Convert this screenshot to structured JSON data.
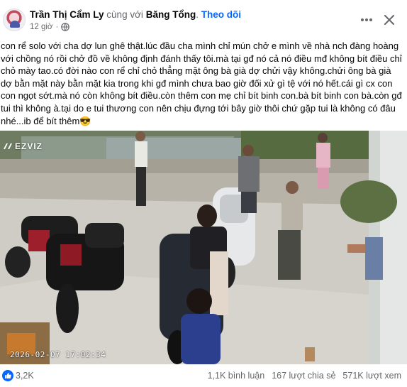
{
  "header": {
    "author": "Trần Thị Cẩm Ly",
    "with_text": "cùng với",
    "tagged": "Băng Tổng",
    "separator": ".",
    "follow_label": "Theo dõi",
    "time": "12 giờ",
    "dot": "·",
    "more_icon": "more-horizontal-icon",
    "close_icon": "close-icon",
    "privacy_icon": "globe-icon"
  },
  "post": {
    "text": "con rể solo với cha dợ lun ghê thật.lúc đầu cha mình chỉ mún chở e mình về nhà nch đàng hoàng với chồng nó rồi chở đồ về không định đánh thấy tôi.mà tại gđ nó cả nó điều mđ không bít điều chỉ chỏ mày tao.có đời nào con rể chỉ chỏ thẳng mặt ông bà già dợ chửi vậy không.chửi ông bà già dợ bằn mặt này bằn mặt kia trong khi gđ mình chưa bao giờ đối xử gì tệ với nó hết.cái gì cx con con ngọt sớt.mà nó còn không bít điều.còn thêm con mẹ chỉ bít binh con.bà bít binh con bà.còn gđ tui thì không à.tại do e tui thương con nên chịu đựng tới bây giờ thôi chứ gặp tui là không có đâu nhé...ib để bít thêm😎"
  },
  "photo": {
    "brand": "EZVIZ",
    "timestamp": "2026-02-07 17:02:34"
  },
  "footer": {
    "reactions": "3,2K",
    "comments": "1,1K bình luận",
    "shares": "167 lượt chia sẻ",
    "views": "571K lượt xem",
    "like_color": "#0866ff"
  }
}
